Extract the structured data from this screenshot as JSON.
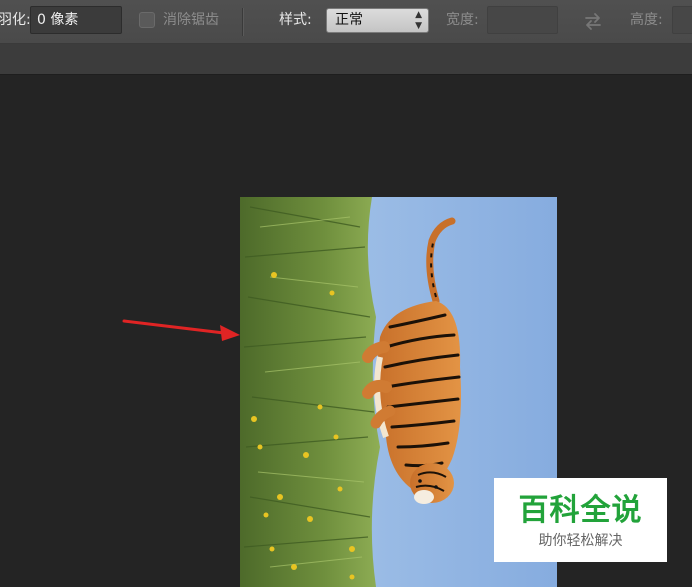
{
  "options_bar": {
    "feather_label": "羽化:",
    "feather_value": "0 像素",
    "antialias_label": "消除锯齿",
    "style_label": "样式:",
    "style_value": "正常",
    "width_label": "宽度:",
    "width_value": "",
    "swap_icon": "swap-arrows-icon",
    "height_label": "高度:",
    "height_value": ""
  },
  "canvas": {
    "image_subject": "tiger-on-grass-photo",
    "annotation": "red-arrow-pointing-right"
  },
  "watermark": {
    "title": "百科全说",
    "subtitle": "助你轻松解决"
  },
  "colors": {
    "toolbar_bg": "#4d4d4d",
    "canvas_bg": "#242424",
    "annotation_arrow": "#e02424",
    "watermark_green": "#22a33a"
  }
}
